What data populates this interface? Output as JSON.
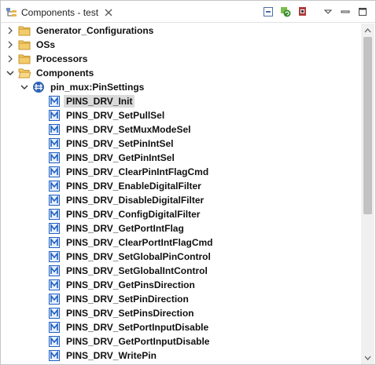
{
  "tab": {
    "title": "Components - test",
    "icon": "component-tree-icon"
  },
  "toolbar": {
    "buttons": [
      "collapse-all-icon",
      "refresh-icon",
      "lock-icon",
      "view-menu-icon",
      "minimize-icon",
      "maximize-icon"
    ]
  },
  "tree": {
    "folders": [
      {
        "label": "Generator_Configurations",
        "expanded": false
      },
      {
        "label": "OSs",
        "expanded": false
      },
      {
        "label": "Processors",
        "expanded": false
      },
      {
        "label": "Components",
        "expanded": true
      }
    ],
    "component": {
      "label": "pin_mux:PinSettings",
      "expanded": true
    },
    "methods": [
      "PINS_DRV_Init",
      "PINS_DRV_SetPullSel",
      "PINS_DRV_SetMuxModeSel",
      "PINS_DRV_SetPinIntSel",
      "PINS_DRV_GetPinIntSel",
      "PINS_DRV_ClearPinIntFlagCmd",
      "PINS_DRV_EnableDigitalFilter",
      "PINS_DRV_DisableDigitalFilter",
      "PINS_DRV_ConfigDigitalFilter",
      "PINS_DRV_GetPortIntFlag",
      "PINS_DRV_ClearPortIntFlagCmd",
      "PINS_DRV_SetGlobalPinControl",
      "PINS_DRV_SetGlobalIntControl",
      "PINS_DRV_GetPinsDirection",
      "PINS_DRV_SetPinDirection",
      "PINS_DRV_SetPinsDirection",
      "PINS_DRV_SetPortInputDisable",
      "PINS_DRV_GetPortInputDisable",
      "PINS_DRV_WritePin"
    ],
    "selected_method": "PINS_DRV_Init"
  },
  "colors": {
    "folder": "#e8b64c",
    "method_icon": "#1f5fbf",
    "selection": "#dadada"
  }
}
